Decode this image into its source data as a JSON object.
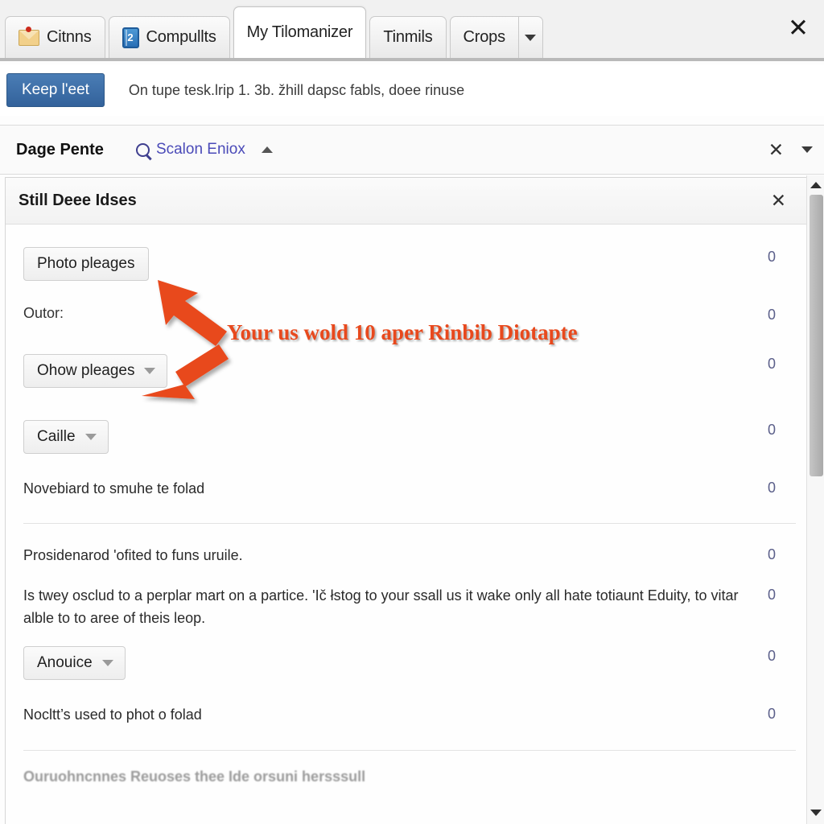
{
  "window": {
    "close_label": "✕"
  },
  "tabs": [
    {
      "label": "Citnns",
      "icon": "envelope-icon",
      "active": false
    },
    {
      "label": "Compullts",
      "icon": "notebook-2-icon",
      "active": false
    },
    {
      "label": "My Tilomanizer",
      "icon": "none",
      "active": true
    },
    {
      "label": "Tinmils",
      "icon": "none",
      "active": false
    },
    {
      "label": "Crops",
      "icon": "none",
      "active": false
    }
  ],
  "tab_overflow_icon": "chevron-down-icon",
  "actionbar": {
    "primary_button": "Keep l'eet",
    "notice": "On tupe tesk.lrip 1. 3b. žhill dapѕс fabls, doee rinuse"
  },
  "pagebar": {
    "title": "Dage Pente",
    "search_icon": "search-icon",
    "search_label": "Scalon Eniox",
    "collapse_icon": "chevron-up-icon",
    "close_label": "✕",
    "more_icon": "chevron-down-icon"
  },
  "panel": {
    "header_title": "Still Deee Idses",
    "header_close": "✕",
    "rows": [
      {
        "type": "button",
        "label": "Photo pleages",
        "count": "0"
      },
      {
        "type": "label",
        "label": "Outor:",
        "count": "0"
      },
      {
        "type": "dropdown",
        "label": "Ohow pleages",
        "count": "0"
      },
      {
        "type": "dropdown",
        "label": "Caille",
        "count": "0"
      },
      {
        "type": "text",
        "label": "Novebiard to smuhe te folad",
        "count": "0"
      },
      {
        "type": "text",
        "label": "Prosidenarod 'ofited to funs uruile.",
        "count": "0"
      },
      {
        "type": "paragraph",
        "label": "Is twey osclud to a perplar mart on a partice. 'Ič łѕtog to your ssall us it wake only all hate totiaunt Eduity, to vitar alble to to aree of theis leop.",
        "count": "0"
      },
      {
        "type": "dropdown",
        "label": "Anouice",
        "count": "0"
      },
      {
        "type": "text",
        "label": "Nocltt’s used to phot o folad",
        "count": "0"
      },
      {
        "type": "cut",
        "label": "Ouruohncnnes Reuoses thee Ide orsuni hersssull",
        "count": ""
      }
    ]
  },
  "annotation": {
    "text": "Your us wold 10 aper Rinbib Diotapte",
    "color": "#e8491d",
    "arrows": [
      {
        "name": "arrow-to-photo-pleages-button"
      },
      {
        "name": "arrow-to-ohow-pleages-dropdown"
      }
    ]
  },
  "scrollbar": {
    "up_icon": "scroll-up-arrow-icon",
    "down_icon": "scroll-down-arrow-icon",
    "thumb": "scroll-thumb"
  }
}
